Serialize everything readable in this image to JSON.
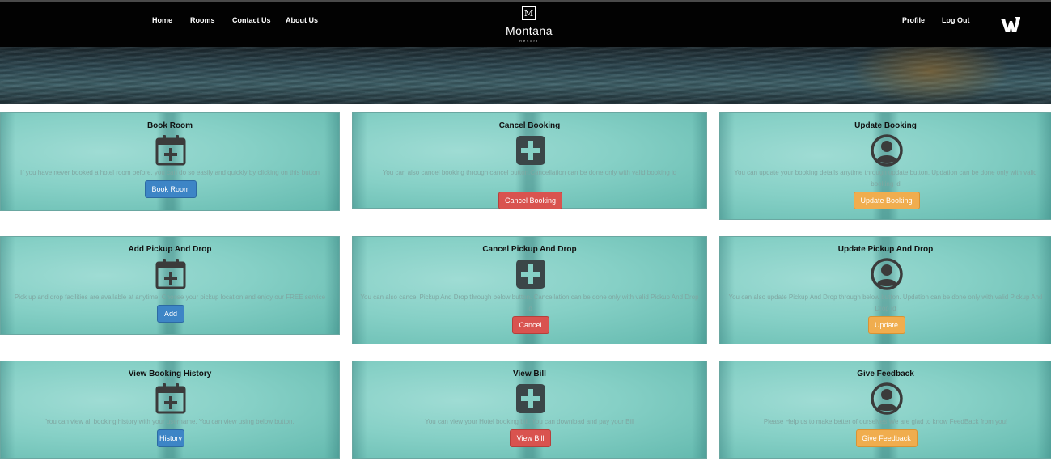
{
  "nav": {
    "home": "Home",
    "rooms": "Rooms",
    "contact": "Contact Us",
    "about": "About Us",
    "profile": "Profile",
    "logout": "Log Out"
  },
  "logo": {
    "mark": "M",
    "name": "Montana",
    "sub": "Resort",
    "brand_icon": "w-logo-icon"
  },
  "cards": [
    {
      "title": "Book Room",
      "icon": "calendar-plus-icon",
      "desc": "If you have never booked a hotel room before, you can do so easily and quickly by clicking on this button",
      "button": "Book Room",
      "button_color": "#3d85c6"
    },
    {
      "title": "Cancel Booking",
      "icon": "plus-square-icon",
      "desc": "You can also cancel booking through cancel button.Cancellation can be done only with valid booking id",
      "button": "Cancel Booking",
      "button_color": "#d9534f"
    },
    {
      "title": "Update Booking",
      "icon": "user-circle-icon",
      "desc": "You can update your booking details anytime through update button. Updation can be done only with valid booking id",
      "button": "Update Booking",
      "button_color": "#f0ad4e"
    },
    {
      "title": "Add Pickup And Drop",
      "icon": "calendar-plus-icon",
      "desc": "Pick up and drop facilities are available at anytime. Choose your pickup location and enjoy our FREE service",
      "button": "Add",
      "button_color": "#3d85c6"
    },
    {
      "title": "Cancel Pickup And Drop",
      "icon": "plus-square-icon",
      "desc": "You can also cancel Pickup And Drop through below button. Cancellation can be done only with valid Pickup And Drop Id",
      "button": "Cancel",
      "button_color": "#d9534f"
    },
    {
      "title": "Update Pickup And Drop",
      "icon": "user-circle-icon",
      "desc": "You can also update Pickup And Drop through below button. Updation can be done only with valid Pickup And Drop Id",
      "button": "Update",
      "button_color": "#f0ad4e"
    },
    {
      "title": "View Booking History",
      "icon": "calendar-plus-icon",
      "desc": "You can view all booking history with your username. You can view using below button.",
      "button": "History",
      "button_color": "#3d85c6"
    },
    {
      "title": "View Bill",
      "icon": "plus-square-icon",
      "desc": "You can view your Hotel booking bill. You can download and pay your Bill",
      "button": "View Bill",
      "button_color": "#d9534f"
    },
    {
      "title": "Give Feedback",
      "icon": "user-circle-icon",
      "desc": "Please Help us to make better of ourselves.We are glad to know FeedBack from you!",
      "button": "Give Feedback",
      "button_color": "#f0ad4e"
    }
  ]
}
